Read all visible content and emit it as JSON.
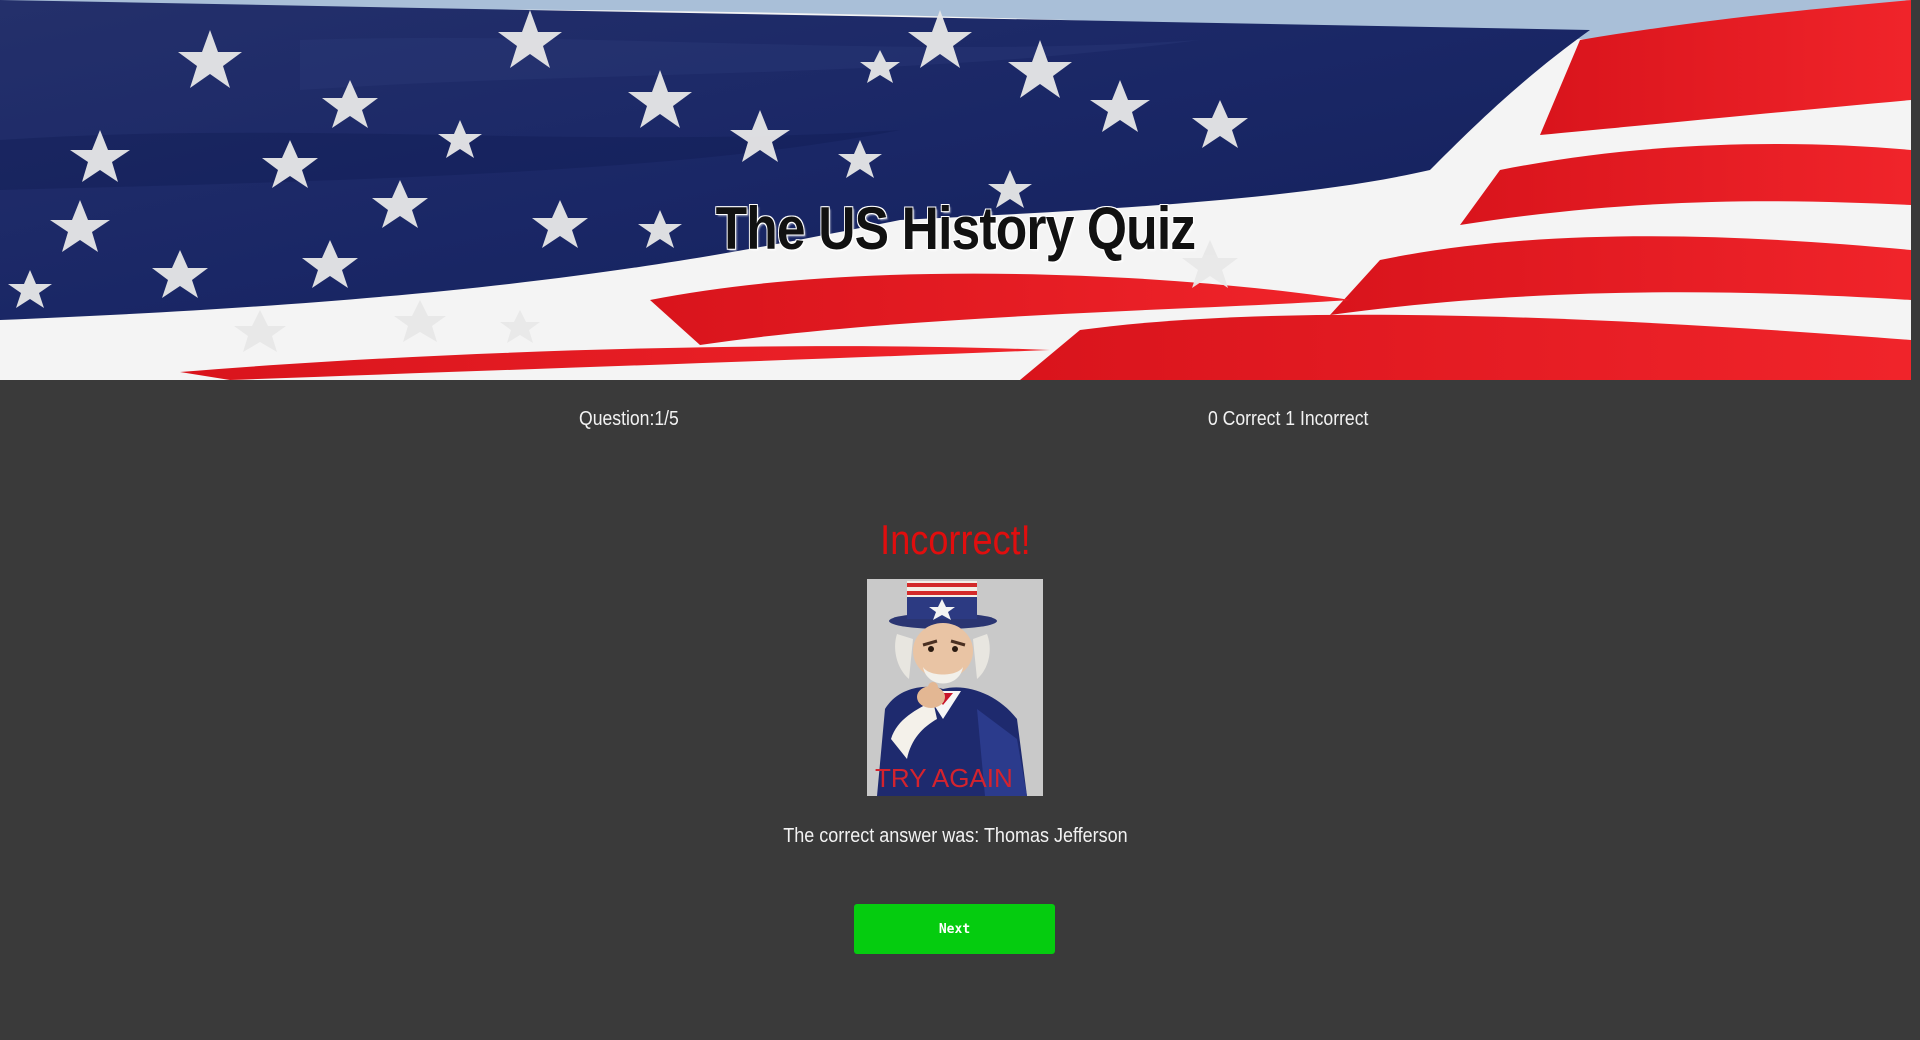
{
  "header": {
    "title": "The US History Quiz",
    "banner_image": "american-flag"
  },
  "status": {
    "question_label": "Question:1/5",
    "score_label": "0 Correct 1 Incorrect"
  },
  "result": {
    "heading": "Incorrect!",
    "heading_color": "#e00e0e",
    "image_caption": "TRY AGAIN",
    "image_subject": "uncle-sam",
    "answer_text": "The correct answer was: Thomas Jefferson"
  },
  "actions": {
    "next_label": "Next",
    "next_color": "#05cc0f"
  },
  "colors": {
    "background": "#3a3a3a",
    "flag_blue": "#1a2a6e",
    "flag_red": "#e3171f"
  }
}
